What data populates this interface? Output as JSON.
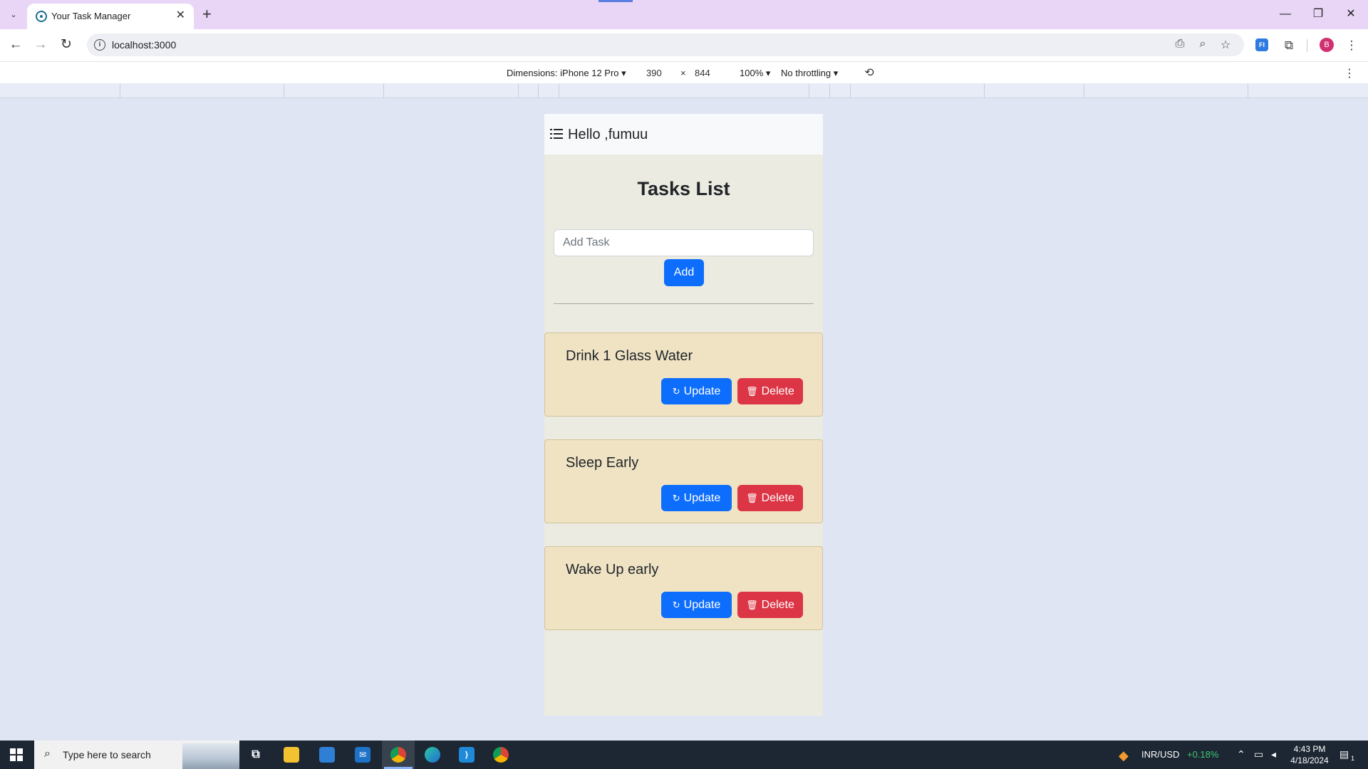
{
  "browser": {
    "tab_title": "Your Task Manager",
    "tab_close": "✕",
    "new_tab": "+",
    "tab_menu": "⌄",
    "url": "localhost:3000",
    "window": {
      "minimize": "—",
      "restore": "❐",
      "close": "✕"
    },
    "nav": {
      "back": "←",
      "forward": "→",
      "reload": "↻"
    },
    "avatar_letter": "B",
    "extension_label": "FI",
    "more": "⋮"
  },
  "devtools": {
    "dimensions_label": "Dimensions: iPhone 12 Pro",
    "width": "390",
    "times": "×",
    "height": "844",
    "zoom": "100%",
    "throttling": "No throttling",
    "dropdown_arrow": "▾"
  },
  "app": {
    "greeting": "Hello ,fumuu",
    "title": "Tasks List",
    "input_placeholder": "Add Task",
    "add_label": "Add",
    "update_label": "Update",
    "delete_label": "Delete",
    "update_icon": "↻",
    "delete_icon": "🗑",
    "tasks": [
      {
        "text": "Drink 1 Glass Water"
      },
      {
        "text": "Sleep Early"
      },
      {
        "text": "Wake Up early"
      }
    ],
    "colors": {
      "primary": "#0d6efd",
      "danger": "#dc3545",
      "card": "#efe3c4",
      "page": "#ecebe1"
    }
  },
  "taskbar": {
    "search_placeholder": "Type here to search",
    "ticker_pair": "INR/USD",
    "ticker_change": "+0.18%",
    "time": "4:43 PM",
    "date": "4/18/2024",
    "notification_count": "1"
  }
}
